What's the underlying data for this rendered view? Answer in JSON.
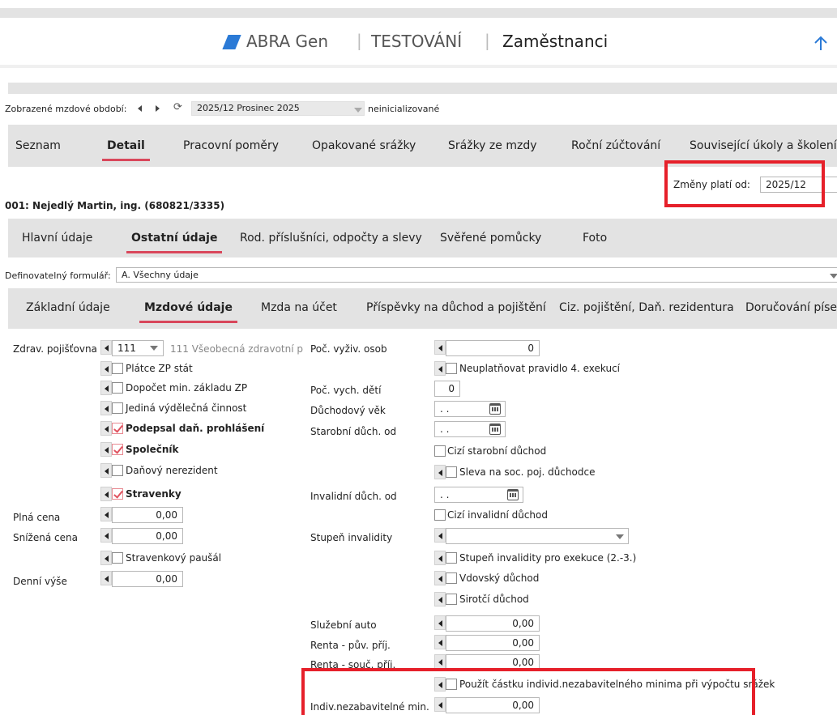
{
  "header": {
    "brand": "ABRA Gen",
    "sep": "|",
    "company": "TESTOVÁNÍ",
    "module": "Zaměstnanci"
  },
  "period": {
    "label": "Zobrazené mzdové období:",
    "value": "2025/12 Prosinec 2025",
    "status": "neinicializované"
  },
  "main_tabs": [
    {
      "label": "Seznam"
    },
    {
      "label": "Detail"
    },
    {
      "label": "Pracovní poměry"
    },
    {
      "label": "Opakované srážky"
    },
    {
      "label": "Srážky ze mzdy"
    },
    {
      "label": "Roční zúčtování"
    },
    {
      "label": "Související úkoly a školení"
    }
  ],
  "changes": {
    "label": "Změny platí od:",
    "value": "2025/12"
  },
  "employee": {
    "title": "001: Nejedlý Martin, ing. (680821/3335)"
  },
  "sub_tabs": [
    {
      "label": "Hlavní údaje"
    },
    {
      "label": "Ostatní údaje"
    },
    {
      "label": "Rod. příslušníci, odpočty a slevy"
    },
    {
      "label": "Svěřené pomůcky"
    },
    {
      "label": "Foto"
    }
  ],
  "form": {
    "label": "Definovatelný formulář:",
    "value": "A. Všechny údaje"
  },
  "inner_tabs": [
    {
      "label": "Základní údaje"
    },
    {
      "label": "Mzdové údaje"
    },
    {
      "label": "Mzda na účet"
    },
    {
      "label": "Příspěvky na důchod a pojištění"
    },
    {
      "label": "Ciz. pojištění, Daň. rezidentura"
    },
    {
      "label": "Doručování písemností"
    }
  ],
  "left": {
    "insurer_label": "Zdrav. pojišťovna",
    "insurer_code": "111",
    "insurer_name": "111 Všeobecná zdravotní p",
    "cb_zp_stat": "Plátce ZP stát",
    "cb_dopocet": "Dopočet min. základu ZP",
    "cb_jedina": "Jediná výdělečná činnost",
    "cb_podepsal": "Podepsal daň. prohlášení",
    "cb_spolecnik": "Společník",
    "cb_nerezident": "Daňový nerezident",
    "cb_stravenky": "Stravenky",
    "plna_label": "Plná cena",
    "plna_value": "0,00",
    "snizena_label": "Snížená cena",
    "snizena_value": "0,00",
    "cb_pausal": "Stravenkový paušál",
    "denni_label": "Denní výše",
    "denni_value": "0,00"
  },
  "right": {
    "vyziv_label": "Poč. vyživ. osob",
    "vyziv_value": "0",
    "cb_neuplat": "Neuplatňovat pravidlo 4. exekucí",
    "deti_label": "Poč. vych. dětí",
    "deti_value": "0",
    "duch_vek_label": "Důchodový věk",
    "date_empty": ". .",
    "starobni_label": "Starobní důch. od",
    "cb_cizi_starobni": "Cizí starobní důchod",
    "cb_sleva": "Sleva na soc. poj. důchodce",
    "invalidni_label": "Invalidní důch. od",
    "cb_cizi_invalidni": "Cizí invalidní důchod",
    "stupen_label": "Stupeň invalidity",
    "cb_stupen_exek": "Stupeň invalidity pro exekuce (2.-3.)",
    "cb_vdovsky": "Vdovský důchod",
    "cb_sirotci": "Sirotčí důchod",
    "auto_label": "Služební auto",
    "auto_value": "0,00",
    "renta_puv_label": "Renta - pův. příj.",
    "renta_puv_value": "0,00",
    "renta_souc_label": "Renta - souč. příj.",
    "renta_souc_value": "0,00",
    "cb_pouzit": "Použít částku individ.nezabavitelného minima při výpočtu srážek",
    "indiv_label": "Indiv.nezabavitelné min.",
    "indiv_value": "0,00"
  },
  "colors": {
    "accent": "#d9475b",
    "brand_blue": "#2b7ad6",
    "highlight": "#e6202a"
  }
}
